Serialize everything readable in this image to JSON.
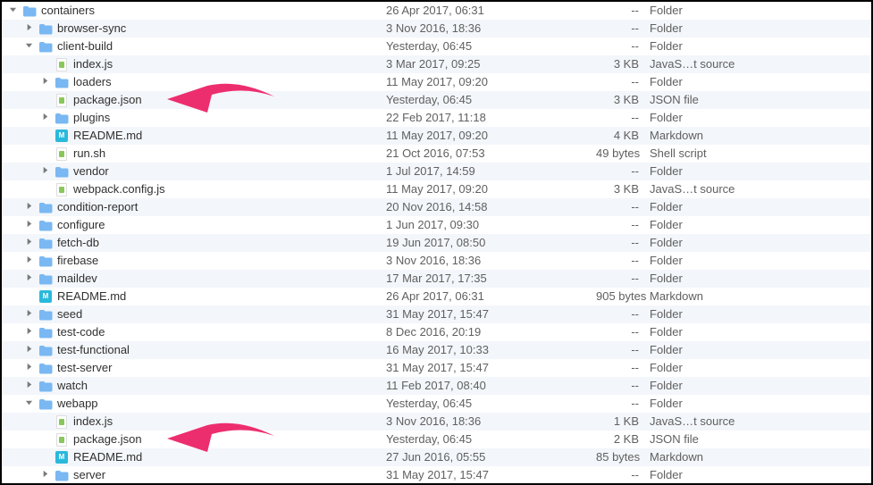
{
  "rows": [
    {
      "depth": 0,
      "expand": "open",
      "iconType": "folder",
      "name": "containers",
      "date": "26 Apr 2017, 06:31",
      "size": "--",
      "kind": "Folder"
    },
    {
      "depth": 1,
      "expand": "closed",
      "iconType": "folder",
      "name": "browser-sync",
      "date": "3 Nov 2016, 18:36",
      "size": "--",
      "kind": "Folder"
    },
    {
      "depth": 1,
      "expand": "open",
      "iconType": "folder",
      "name": "client-build",
      "date": "Yesterday, 06:45",
      "size": "--",
      "kind": "Folder"
    },
    {
      "depth": 2,
      "expand": "none",
      "iconType": "js",
      "name": "index.js",
      "date": "3 Mar 2017, 09:25",
      "size": "3 KB",
      "kind": "JavaS…t source"
    },
    {
      "depth": 2,
      "expand": "closed",
      "iconType": "folder",
      "name": "loaders",
      "date": "11 May 2017, 09:20",
      "size": "--",
      "kind": "Folder"
    },
    {
      "depth": 2,
      "expand": "none",
      "iconType": "json",
      "name": "package.json",
      "date": "Yesterday, 06:45",
      "size": "3 KB",
      "kind": "JSON file",
      "arrow": true
    },
    {
      "depth": 2,
      "expand": "closed",
      "iconType": "folder",
      "name": "plugins",
      "date": "22 Feb 2017, 11:18",
      "size": "--",
      "kind": "Folder"
    },
    {
      "depth": 2,
      "expand": "none",
      "iconType": "md",
      "name": "README.md",
      "date": "11 May 2017, 09:20",
      "size": "4 KB",
      "kind": "Markdown"
    },
    {
      "depth": 2,
      "expand": "none",
      "iconType": "sh",
      "name": "run.sh",
      "date": "21 Oct 2016, 07:53",
      "size": "49 bytes",
      "kind": "Shell script"
    },
    {
      "depth": 2,
      "expand": "closed",
      "iconType": "folder",
      "name": "vendor",
      "date": "1 Jul 2017, 14:59",
      "size": "--",
      "kind": "Folder"
    },
    {
      "depth": 2,
      "expand": "none",
      "iconType": "js",
      "name": "webpack.config.js",
      "date": "11 May 2017, 09:20",
      "size": "3 KB",
      "kind": "JavaS…t source"
    },
    {
      "depth": 1,
      "expand": "closed",
      "iconType": "folder",
      "name": "condition-report",
      "date": "20 Nov 2016, 14:58",
      "size": "--",
      "kind": "Folder"
    },
    {
      "depth": 1,
      "expand": "closed",
      "iconType": "folder",
      "name": "configure",
      "date": "1 Jun 2017, 09:30",
      "size": "--",
      "kind": "Folder"
    },
    {
      "depth": 1,
      "expand": "closed",
      "iconType": "folder",
      "name": "fetch-db",
      "date": "19 Jun 2017, 08:50",
      "size": "--",
      "kind": "Folder"
    },
    {
      "depth": 1,
      "expand": "closed",
      "iconType": "folder",
      "name": "firebase",
      "date": "3 Nov 2016, 18:36",
      "size": "--",
      "kind": "Folder"
    },
    {
      "depth": 1,
      "expand": "closed",
      "iconType": "folder",
      "name": "maildev",
      "date": "17 Mar 2017, 17:35",
      "size": "--",
      "kind": "Folder"
    },
    {
      "depth": 1,
      "expand": "none",
      "iconType": "md",
      "name": "README.md",
      "date": "26 Apr 2017, 06:31",
      "size": "905 bytes",
      "kind": "Markdown"
    },
    {
      "depth": 1,
      "expand": "closed",
      "iconType": "folder",
      "name": "seed",
      "date": "31 May 2017, 15:47",
      "size": "--",
      "kind": "Folder"
    },
    {
      "depth": 1,
      "expand": "closed",
      "iconType": "folder",
      "name": "test-code",
      "date": "8 Dec 2016, 20:19",
      "size": "--",
      "kind": "Folder"
    },
    {
      "depth": 1,
      "expand": "closed",
      "iconType": "folder",
      "name": "test-functional",
      "date": "16 May 2017, 10:33",
      "size": "--",
      "kind": "Folder"
    },
    {
      "depth": 1,
      "expand": "closed",
      "iconType": "folder",
      "name": "test-server",
      "date": "31 May 2017, 15:47",
      "size": "--",
      "kind": "Folder"
    },
    {
      "depth": 1,
      "expand": "closed",
      "iconType": "folder",
      "name": "watch",
      "date": "11 Feb 2017, 08:40",
      "size": "--",
      "kind": "Folder"
    },
    {
      "depth": 1,
      "expand": "open",
      "iconType": "folder",
      "name": "webapp",
      "date": "Yesterday, 06:45",
      "size": "--",
      "kind": "Folder"
    },
    {
      "depth": 2,
      "expand": "none",
      "iconType": "js",
      "name": "index.js",
      "date": "3 Nov 2016, 18:36",
      "size": "1 KB",
      "kind": "JavaS…t source"
    },
    {
      "depth": 2,
      "expand": "none",
      "iconType": "json",
      "name": "package.json",
      "date": "Yesterday, 06:45",
      "size": "2 KB",
      "kind": "JSON file",
      "arrow": true
    },
    {
      "depth": 2,
      "expand": "none",
      "iconType": "md",
      "name": "README.md",
      "date": "27 Jun 2016, 05:55",
      "size": "85 bytes",
      "kind": "Markdown"
    },
    {
      "depth": 2,
      "expand": "closed",
      "iconType": "folder",
      "name": "server",
      "date": "31 May 2017, 15:47",
      "size": "--",
      "kind": "Folder"
    }
  ],
  "icons": {
    "mdLabel": "M"
  }
}
